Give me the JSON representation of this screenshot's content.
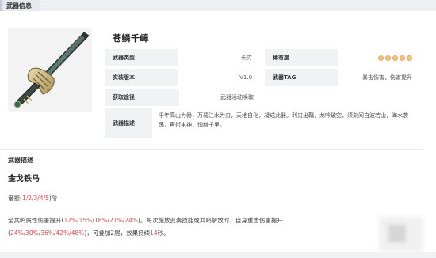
{
  "header": {
    "tab_label": "武器信息"
  },
  "weapon": {
    "name": "苍鳞千嶂",
    "rows": [
      {
        "label": "武器类型",
        "value": "长刃"
      },
      {
        "label": "稀有度",
        "value": ""
      },
      {
        "label": "实装版本",
        "value": "V1.0"
      },
      {
        "label": "武器TAG",
        "value": "暴击伤害，伤害提升"
      },
      {
        "label": "获取途径",
        "value": "武器活动唤取"
      }
    ],
    "rarity_stars": 5,
    "desc_label": "武器描述",
    "desc_text": "千年高山为骨，万载江水为刃，天地自化，凝成此器。利刃出鞘，龙吟破空，须刻间白波若山，海水袭荡，声衔电神，惮赫千里。"
  },
  "skill": {
    "section_title": "武器描述",
    "name": "金戈铁马",
    "refine_prefix": "谐振(",
    "refine_levels": "1/2/3/4/5",
    "refine_suffix": ")阶",
    "line1_a": "全共鸣属性伤害提升(",
    "line1_b": "12%/15%/18%/21%/24%",
    "line1_c": ")。每次施放变奏技能或共鸣解放时，自身重击伤害提升",
    "line2_a": "(",
    "line2_b": "24%/30%/36%/42%/48%",
    "line2_c": ")，可叠加2层，效果持续",
    "line2_d": "14",
    "line2_e": "秒。"
  },
  "colors": {
    "accent_red": "#e04848",
    "star": "#f3c488",
    "label_bg": "#f1f2f4"
  }
}
